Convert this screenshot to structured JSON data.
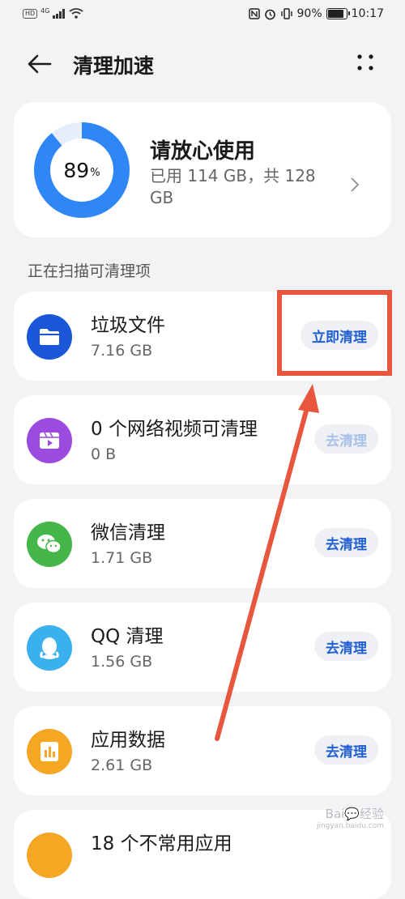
{
  "status_bar": {
    "hd": "HD",
    "network": "4G",
    "battery": "90%",
    "battery_level": 0.9,
    "time": "10:17"
  },
  "app_bar": {
    "title": "清理加速",
    "back_icon": "arrow-left-icon",
    "more_icon": "more-dots-icon"
  },
  "summary": {
    "percent": "89",
    "percent_unit": "%",
    "percent_value": 0.89,
    "title": "请放心使用",
    "subtitle": "已用 114 GB，共 128 GB",
    "ring_color": "#2f86f6"
  },
  "section_title": "正在扫描可清理项",
  "items": [
    {
      "name": "垃圾文件",
      "size": "7.16 GB",
      "button": "立即清理",
      "icon": "folder-icon",
      "color": "#1a56d8"
    },
    {
      "name": "0 个网络视频可清理",
      "size": "0 B",
      "button": "去清理",
      "icon": "video-icon",
      "color": "#9c4be0"
    },
    {
      "name": "微信清理",
      "size": "1.71 GB",
      "button": "去清理",
      "icon": "wechat-icon",
      "color": "#45b649"
    },
    {
      "name": "QQ 清理",
      "size": "1.56 GB",
      "button": "去清理",
      "icon": "qq-icon",
      "color": "#3ab0ee"
    },
    {
      "name": "应用数据",
      "size": "2.61 GB",
      "button": "去清理",
      "icon": "app-data-icon",
      "color": "#f5a623"
    },
    {
      "name": "18 个不常用应用",
      "size": "",
      "button": "",
      "icon": "apps-icon",
      "color": "#f5a623"
    }
  ],
  "watermark": {
    "text": "Bai💬经验",
    "url": "jingyan.baidu.com"
  },
  "annotation_color": "#e8563d"
}
